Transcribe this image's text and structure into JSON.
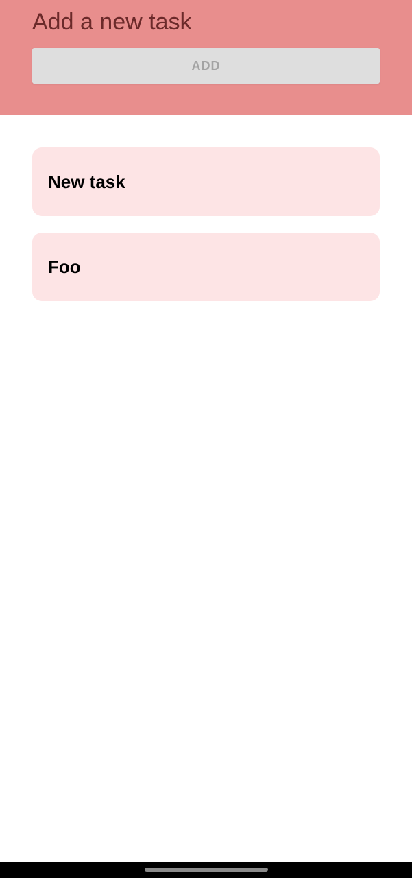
{
  "header": {
    "input_placeholder": "Add a new task",
    "input_value": "",
    "add_label": "ADD"
  },
  "tasks": [
    {
      "title": "New task"
    },
    {
      "title": "Foo"
    }
  ],
  "colors": {
    "header_bg": "#e88e8d",
    "card_bg": "#fde4e5",
    "button_bg": "#dedede",
    "button_text": "#a3a3a3"
  }
}
